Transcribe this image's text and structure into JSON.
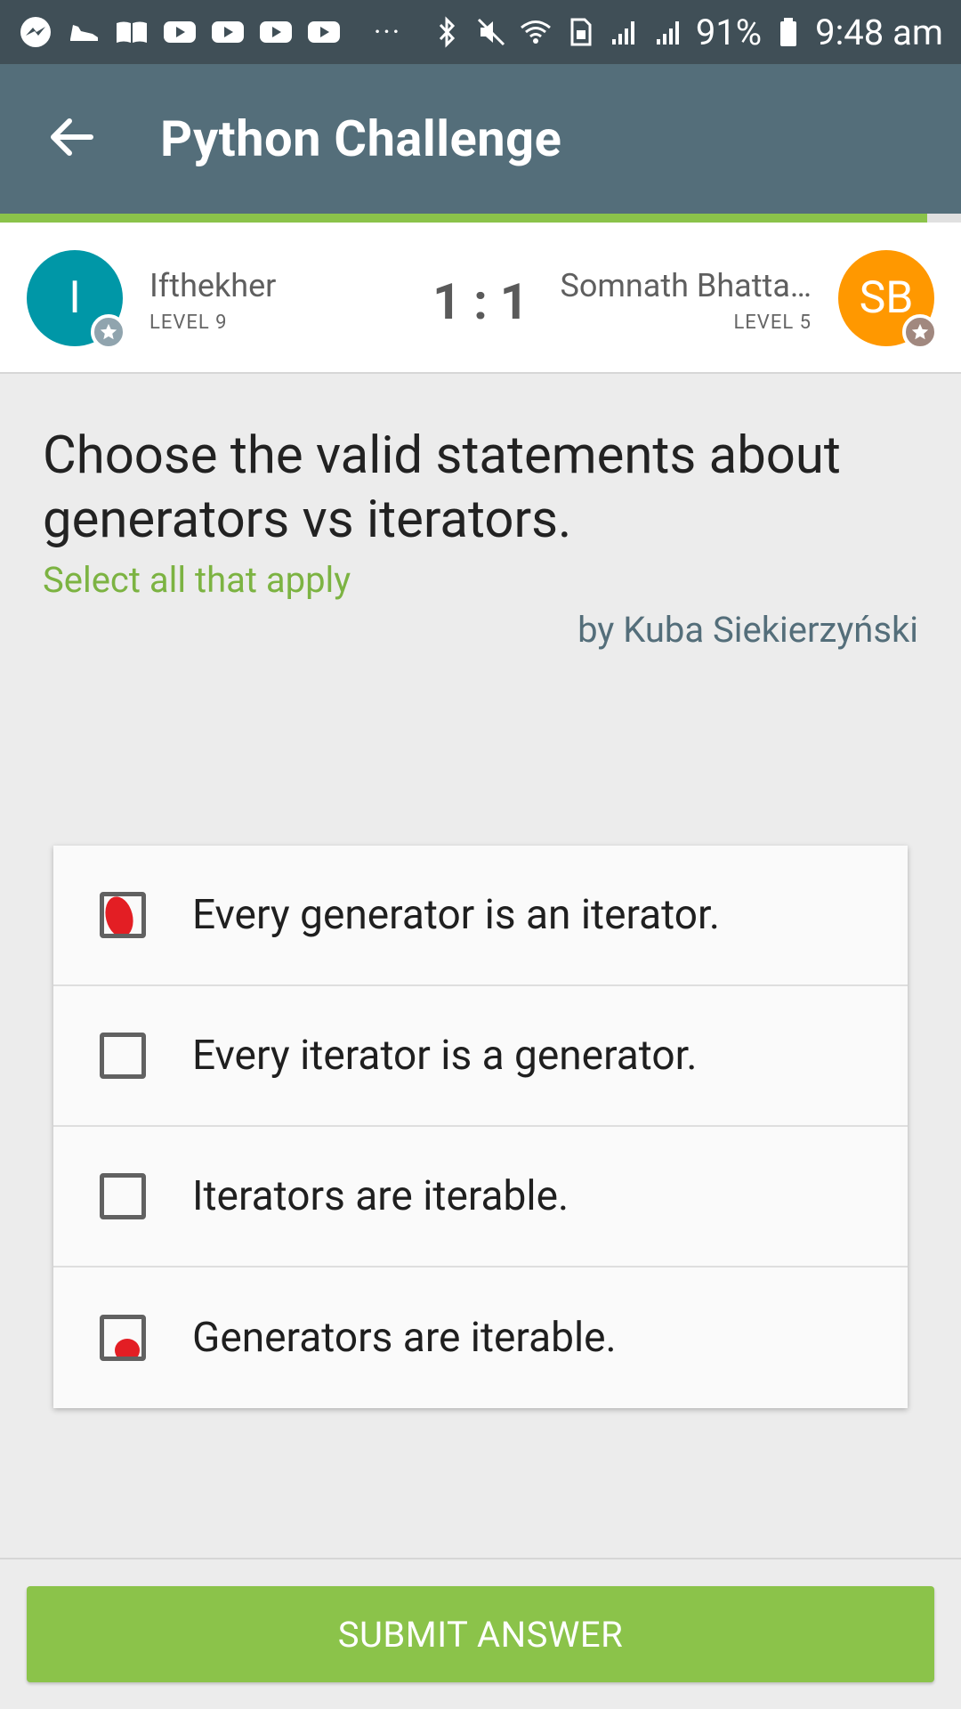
{
  "status_bar": {
    "battery": "91%",
    "time": "9:48 am",
    "overflow": "···",
    "icons": [
      "messenger-icon",
      "shoe-icon",
      "book-icon",
      "youtube-icon",
      "youtube-icon",
      "youtube-icon",
      "youtube-icon",
      "bluetooth-icon",
      "mute-icon",
      "wifi-icon",
      "sim-icon",
      "signal-icon",
      "signal-icon",
      "battery-icon"
    ]
  },
  "header": {
    "title": "Python Challenge",
    "back_icon": "arrow-back-icon"
  },
  "progress": {
    "fraction": 0.965
  },
  "match": {
    "player1": {
      "initial": "I",
      "name": "Ifthekher",
      "level": "LEVEL 9",
      "color": "#0097a7"
    },
    "score": "1 : 1",
    "player2": {
      "initial": "SB",
      "name": "Somnath Bhatta…",
      "level": "LEVEL 5",
      "color": "#ff9800"
    }
  },
  "question": {
    "text": "Choose the valid statements about generators vs iterators.",
    "hint": "Select all that apply",
    "author": "by Kuba Siekierzyński"
  },
  "options": [
    {
      "label": "Every generator is an iterator.",
      "marked": true
    },
    {
      "label": "Every iterator is a generator.",
      "marked": false
    },
    {
      "label": "Iterators are iterable.",
      "marked": false
    },
    {
      "label": "Generators are iterable.",
      "marked": true
    }
  ],
  "footer": {
    "submit_label": "SUBMIT ANSWER"
  },
  "colors": {
    "accent": "#8bc34a",
    "appbar": "#546e7a",
    "statusbar": "#404f57",
    "mark": "#e31e24"
  }
}
